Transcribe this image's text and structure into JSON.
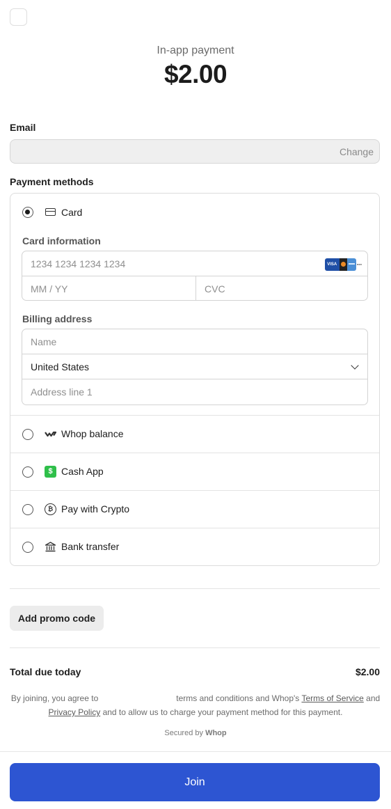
{
  "header": {
    "title": "In-app payment",
    "price": "$2.00"
  },
  "email": {
    "label": "Email",
    "value": "",
    "change_label": "Change"
  },
  "payment": {
    "label": "Payment methods",
    "card": {
      "label": "Card",
      "selected": true,
      "card_info_label": "Card information",
      "number_placeholder": "1234 1234 1234 1234",
      "expiry_placeholder": "MM / YY",
      "cvc_placeholder": "CVC",
      "brand_icons": [
        "visa-icon",
        "mastercard-icon",
        "amex-icon",
        "more-brands-icon"
      ],
      "brand_visa_text": "VISA",
      "billing_label": "Billing address",
      "name_placeholder": "Name",
      "country": "United States",
      "address_placeholder": "Address line 1"
    },
    "methods": [
      {
        "label": "Whop balance",
        "icon": "whop-logo-icon"
      },
      {
        "label": "Cash App",
        "icon": "cash-app-icon",
        "icon_glyph": "$"
      },
      {
        "label": "Pay with Crypto",
        "icon": "bitcoin-icon",
        "icon_glyph": "₿"
      },
      {
        "label": "Bank transfer",
        "icon": "bank-icon"
      }
    ]
  },
  "promo": {
    "label": "Add promo code"
  },
  "total": {
    "label": "Total due today",
    "value": "$2.00"
  },
  "terms": {
    "prefix": "By joining, you agree to",
    "middle": "terms and conditions and Whop's",
    "tos_link": "Terms of Service",
    "and": "and",
    "privacy_link": "Privacy Policy",
    "suffix": "and to allow us to charge your payment method for this payment."
  },
  "secured": {
    "prefix": "Secured by",
    "brand": "Whop"
  },
  "join_label": "Join",
  "colors": {
    "primary": "#2d55d2",
    "cash_app": "#2fbf4a",
    "visa": "#1f4fa6"
  }
}
